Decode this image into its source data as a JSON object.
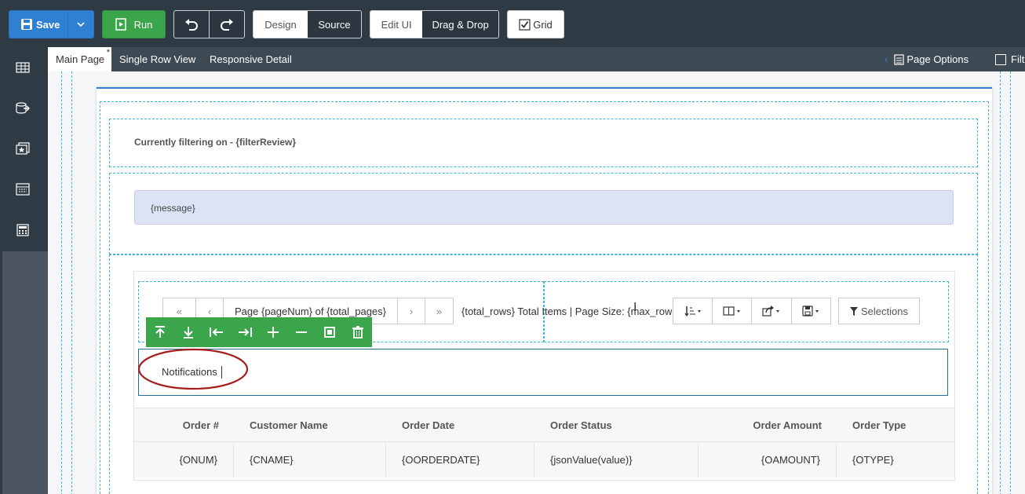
{
  "toolbar": {
    "save_label": "Save",
    "run_label": "Run",
    "design_label": "Design",
    "source_label": "Source",
    "edit_ui_label": "Edit UI",
    "drag_drop_label": "Drag & Drop",
    "grid_label": "Grid",
    "grid_checked": true
  },
  "tabs": {
    "main_page": "Main Page",
    "main_page_modified": "*",
    "single_row_view": "Single Row View",
    "responsive_detail": "Responsive Detail",
    "page_options": "Page Options",
    "filter_partial": "Filt"
  },
  "content": {
    "filter_review": "Currently filtering on - {filterReview}",
    "message": "{message}",
    "pager": {
      "first": "«",
      "prev": "‹",
      "page_text": "Page {pageNum} of {total_pages}",
      "next": "›",
      "last": "»"
    },
    "total_rows": "{total_rows} Total Items | Page Size: {max_rows",
    "selections_label": "Selections",
    "notifications_label": "Notifications"
  },
  "table": {
    "headers": [
      "Order #",
      "Customer Name",
      "Order Date",
      "Order Status",
      "Order Amount",
      "Order Type"
    ],
    "row": [
      "{ONUM}",
      "{CNAME}",
      "{OORDERDATE}",
      "{jsonValue(value)}",
      "{OAMOUNT}",
      "{OTYPE}"
    ]
  },
  "colors": {
    "toolbar_bg": "#2f3b44",
    "accent_blue": "#2f80d1",
    "accent_green": "#3aa54a",
    "message_bg": "#dbe3f4",
    "dashed_border": "#3bb6d4",
    "highlight_circle": "#b22222"
  }
}
